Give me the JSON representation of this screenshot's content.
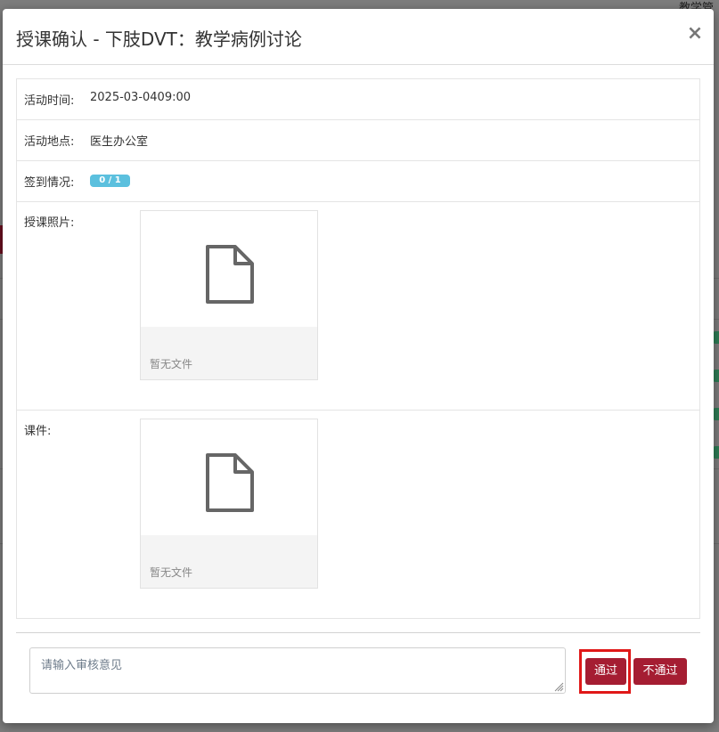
{
  "background": {
    "top_right_text": "教学管"
  },
  "modal": {
    "title": "授课确认 - 下肢DVT：教学病例讨论",
    "close_symbol": "×"
  },
  "details": {
    "time_label": "活动时间:",
    "time_value": "2025-03-0409:00",
    "location_label": "活动地点:",
    "location_value": "医生办公室",
    "signin_label": "签到情况:",
    "signin_badge": "0 / 1",
    "photo_label": "授课照片:",
    "photo_empty": "暂无文件",
    "courseware_label": "课件:",
    "courseware_empty": "暂无文件"
  },
  "review": {
    "placeholder": "请输入审核意见",
    "pass_label": "通过",
    "reject_label": "不通过"
  },
  "colors": {
    "primary": "#a51d32",
    "badge": "#5bc0de",
    "highlight": "#e01818"
  },
  "icons": {
    "file": "document-icon",
    "close": "close-icon"
  }
}
